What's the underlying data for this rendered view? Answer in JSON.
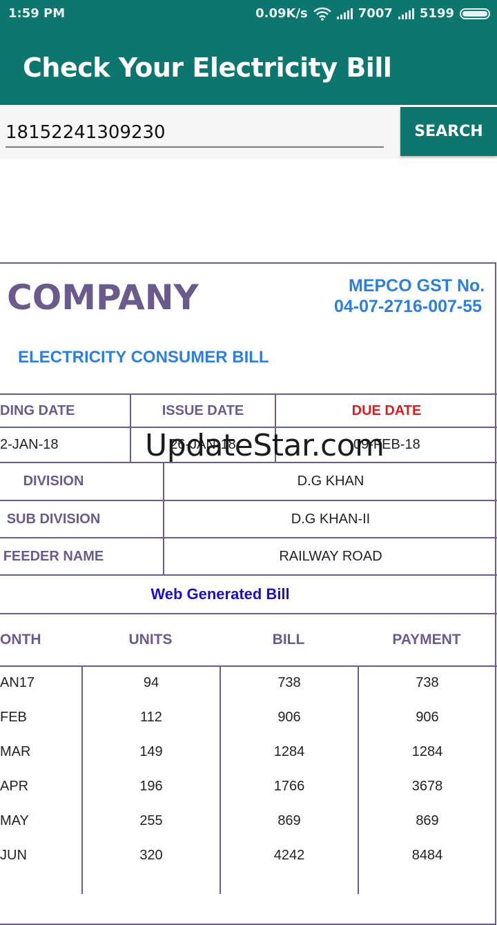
{
  "status_bar": {
    "time": "1:59 PM",
    "network_speed": "0.09K/s",
    "sim1_signal": "7007",
    "sim2_signal": "5199",
    "icons": [
      "wifi-icon",
      "signal-icon",
      "battery-icon"
    ]
  },
  "app_bar": {
    "title": "Check Your Electricity Bill"
  },
  "search": {
    "value": "18152241309230",
    "button_label": "SEARCH"
  },
  "bill": {
    "company": "COMPANY",
    "gst_label": "MEPCO GST No.",
    "gst_number": "04-07-2716-007-55",
    "consumer_bill_title": "ELECTRICITY CONSUMER BILL",
    "dates": {
      "reading_label": "DING DATE",
      "issue_label": "ISSUE DATE",
      "due_label": "DUE DATE",
      "reading_value": "2-JAN-18",
      "issue_value": "26-JAN-18",
      "due_value": "09-FEB-18"
    },
    "info_rows": [
      {
        "label": "DIVISION",
        "value": "D.G KHAN"
      },
      {
        "label": "SUB DIVISION",
        "value": "D.G KHAN-II"
      },
      {
        "label": "FEEDER NAME",
        "value": "RAILWAY ROAD"
      }
    ],
    "web_generated": "Web Generated Bill",
    "history_headers": [
      "ONTH",
      "UNITS",
      "BILL",
      "PAYMENT"
    ],
    "history": [
      [
        "AN17",
        "94",
        "738",
        "738"
      ],
      [
        "FEB",
        "112",
        "906",
        "906"
      ],
      [
        "MAR",
        "149",
        "1284",
        "1284"
      ],
      [
        "APR",
        "196",
        "1766",
        "3678"
      ],
      [
        "MAY",
        "255",
        "869",
        "869"
      ],
      [
        "JUN",
        "320",
        "4242",
        "8484"
      ]
    ]
  },
  "watermark": "UpdateStar.com",
  "colors": {
    "primary": "#0d766e",
    "table_border": "#6b5a8c",
    "gst_blue": "#2d7fd9",
    "due_red": "#d91e1e"
  }
}
